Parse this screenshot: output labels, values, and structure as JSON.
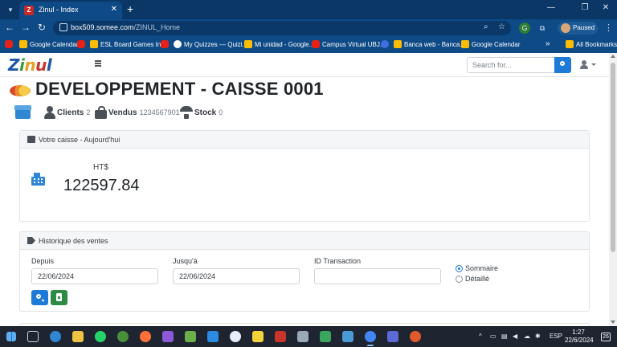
{
  "browser": {
    "tab_title": "Zinul - Index",
    "favicon_letter": "Z",
    "url_host": "box509.somee.com",
    "url_path": "/ZINUL_Home",
    "profile_label": "Paused",
    "bookmarks": [
      "Google Calendar",
      "ESL Board Games In...",
      "My Quizzes — Quizi...",
      "Mi unidad - Google...",
      "Campus Virtual UBJ...",
      "Banca web - Banca...",
      "Google Calendar"
    ],
    "all_bookmarks": "All Bookmarks"
  },
  "navbar": {
    "search_placeholder": "Search for..."
  },
  "page": {
    "title": "DEVELOPPEMENT - CAISSE 0001",
    "stats": {
      "clients_label": "Clients",
      "clients_value": "2",
      "vendus_label": "Vendus",
      "vendus_value": "1234567901",
      "stock_label": "Stock",
      "stock_value": "0"
    }
  },
  "caisse_card": {
    "header": "Votre caisse - Aujourd'hui",
    "ht_label": "HT$",
    "ht_value": "122597.84"
  },
  "history_card": {
    "header": "Historique des ventes",
    "depuis_label": "Depuis",
    "depuis_value": "22/06/2024",
    "jusqua_label": "Jusqu'à",
    "jusqua_value": "22/06/2024",
    "transaction_label": "ID Transaction",
    "transaction_value": "",
    "radio_sommaire": "Sommaire",
    "radio_detaille": "Détaillé",
    "selected": "Sommaire"
  },
  "taskbar": {
    "language": "ESP",
    "time": "1:27",
    "date": "22/6/2024",
    "notification_count": "26"
  },
  "colors": {
    "primary": "#1e7ad7",
    "success": "#2e8b46",
    "browser_chrome": "#0e4a85"
  }
}
